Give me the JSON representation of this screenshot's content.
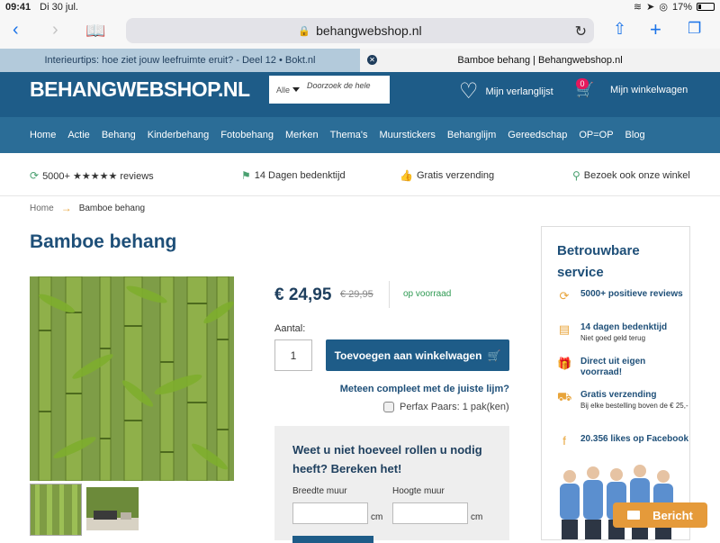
{
  "status": {
    "time": "09:41",
    "date": "Di 30 jul.",
    "battery": "17%"
  },
  "browser": {
    "url": "behangwebshop.nl"
  },
  "tabs": [
    {
      "label": "Interieurtips: hoe ziet jouw leefruimte eruit? - Deel 12 • Bokt.nl"
    },
    {
      "label": "Bamboe behang | Behangwebshop.nl"
    }
  ],
  "header": {
    "logo": "BEHANGWEBSHOP.NL",
    "search_select": "Alle",
    "search_placeholder": "Doorzoek de hele",
    "wishlist": "Mijn verlanglijst",
    "cart": "Mijn winkelwagen",
    "cart_count": "0"
  },
  "nav": [
    "Home",
    "Actie",
    "Behang",
    "Kinderbehang",
    "Fotobehang",
    "Merken",
    "Thema's",
    "Muurstickers",
    "Behanglijm",
    "Gereedschap",
    "OP=OP",
    "Blog"
  ],
  "usp": [
    {
      "text": "5000+ ★★★★★ reviews"
    },
    {
      "text": "14 Dagen bedenktijd"
    },
    {
      "text": "Gratis verzending"
    },
    {
      "text": "Bezoek ook onze winkel"
    }
  ],
  "breadcrumb": {
    "home": "Home",
    "current": "Bamboe behang"
  },
  "product": {
    "title": "Bamboe behang",
    "price": "€ 24,95",
    "old_price": "€ 29,95",
    "stock": "op voorraad",
    "qty_label": "Aantal:",
    "qty": "1",
    "add_label": "Toevoegen aan winkelwagen",
    "measure_link": "Meteen compleet met de juiste lijm?",
    "perfax": "Perfax Paars: 1 pak(ken)"
  },
  "calculator": {
    "title": "Weet u niet hoeveel rollen u nodig heeft? Bereken het!",
    "width_label": "Breedte muur",
    "height_label": "Hoogte muur",
    "unit": "cm"
  },
  "service": {
    "title": "Betrouwbare service",
    "items": [
      {
        "title": "5000+ positieve reviews",
        "sub": ""
      },
      {
        "title": "14 dagen bedenktijd",
        "sub": "Niet goed geld terug"
      },
      {
        "title": "Direct uit eigen voorraad!",
        "sub": ""
      },
      {
        "title": "Gratis verzending",
        "sub": "Bij elke bestelling boven de € 25,-"
      },
      {
        "title": "20.356 likes op Facebook",
        "sub": ""
      }
    ]
  },
  "chat": {
    "label": "Bericht"
  },
  "colors": {
    "header": "#1e5c88",
    "nav": "#2b6d97",
    "accent": "#e8a43a",
    "stock": "#2f9a53"
  }
}
